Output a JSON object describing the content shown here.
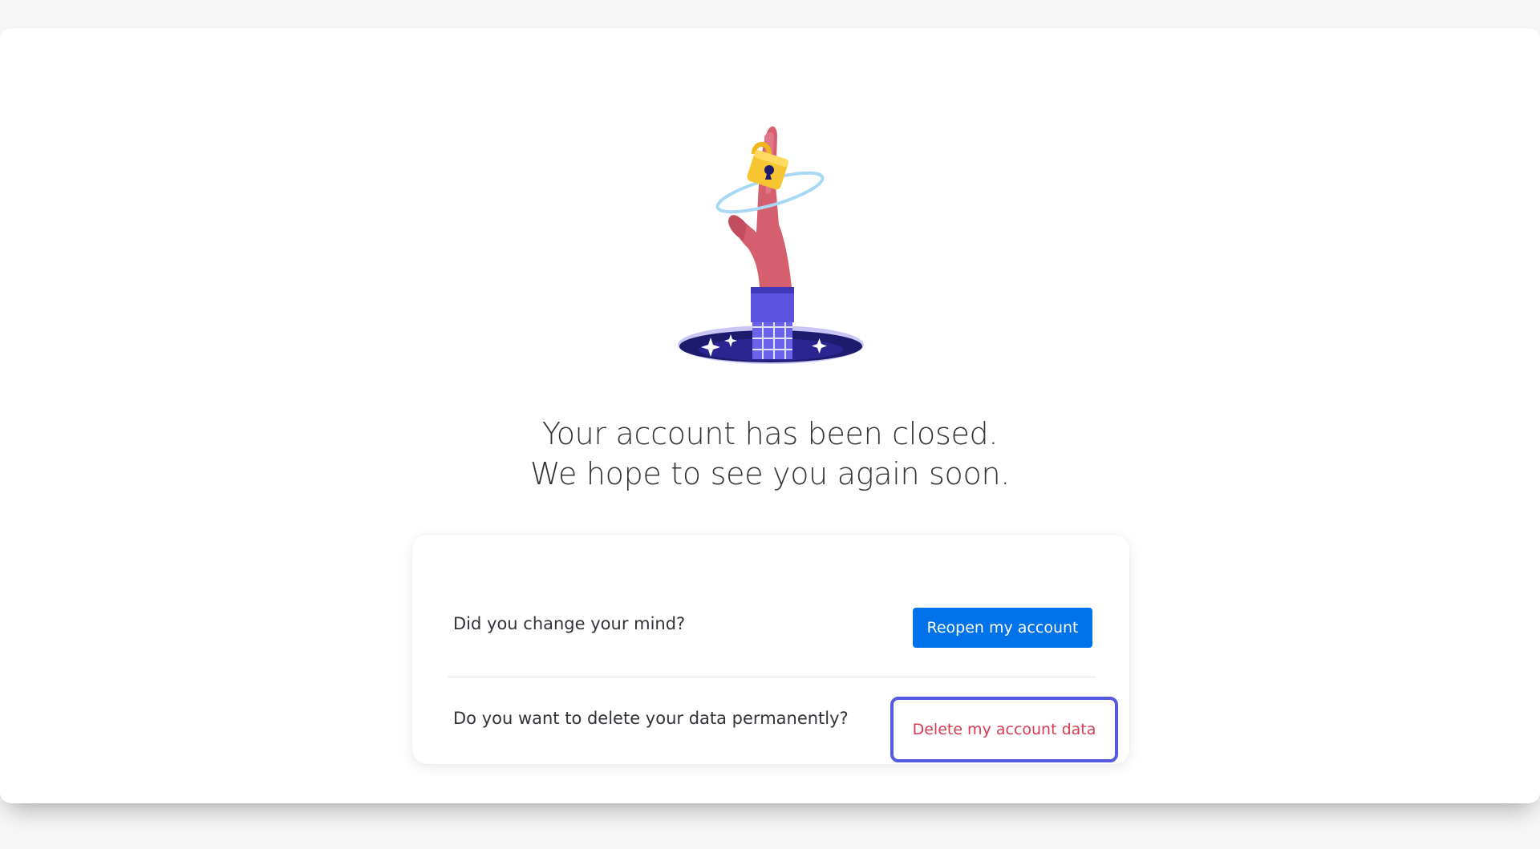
{
  "headline": {
    "line1": "Your account has been closed.",
    "line2": "We hope to see you again soon."
  },
  "reopen": {
    "question": "Did you change your mind?",
    "button_label": "Reopen my account"
  },
  "delete": {
    "question": "Do you want to delete your data permanently?",
    "button_label": "Delete my account data"
  },
  "colors": {
    "primary": "#0073ea",
    "danger": "#d83a52",
    "focus_ring": "#5559df",
    "text": "#323338"
  },
  "illustration": {
    "icon": "hand-holding-padlock-from-portal-icon"
  }
}
